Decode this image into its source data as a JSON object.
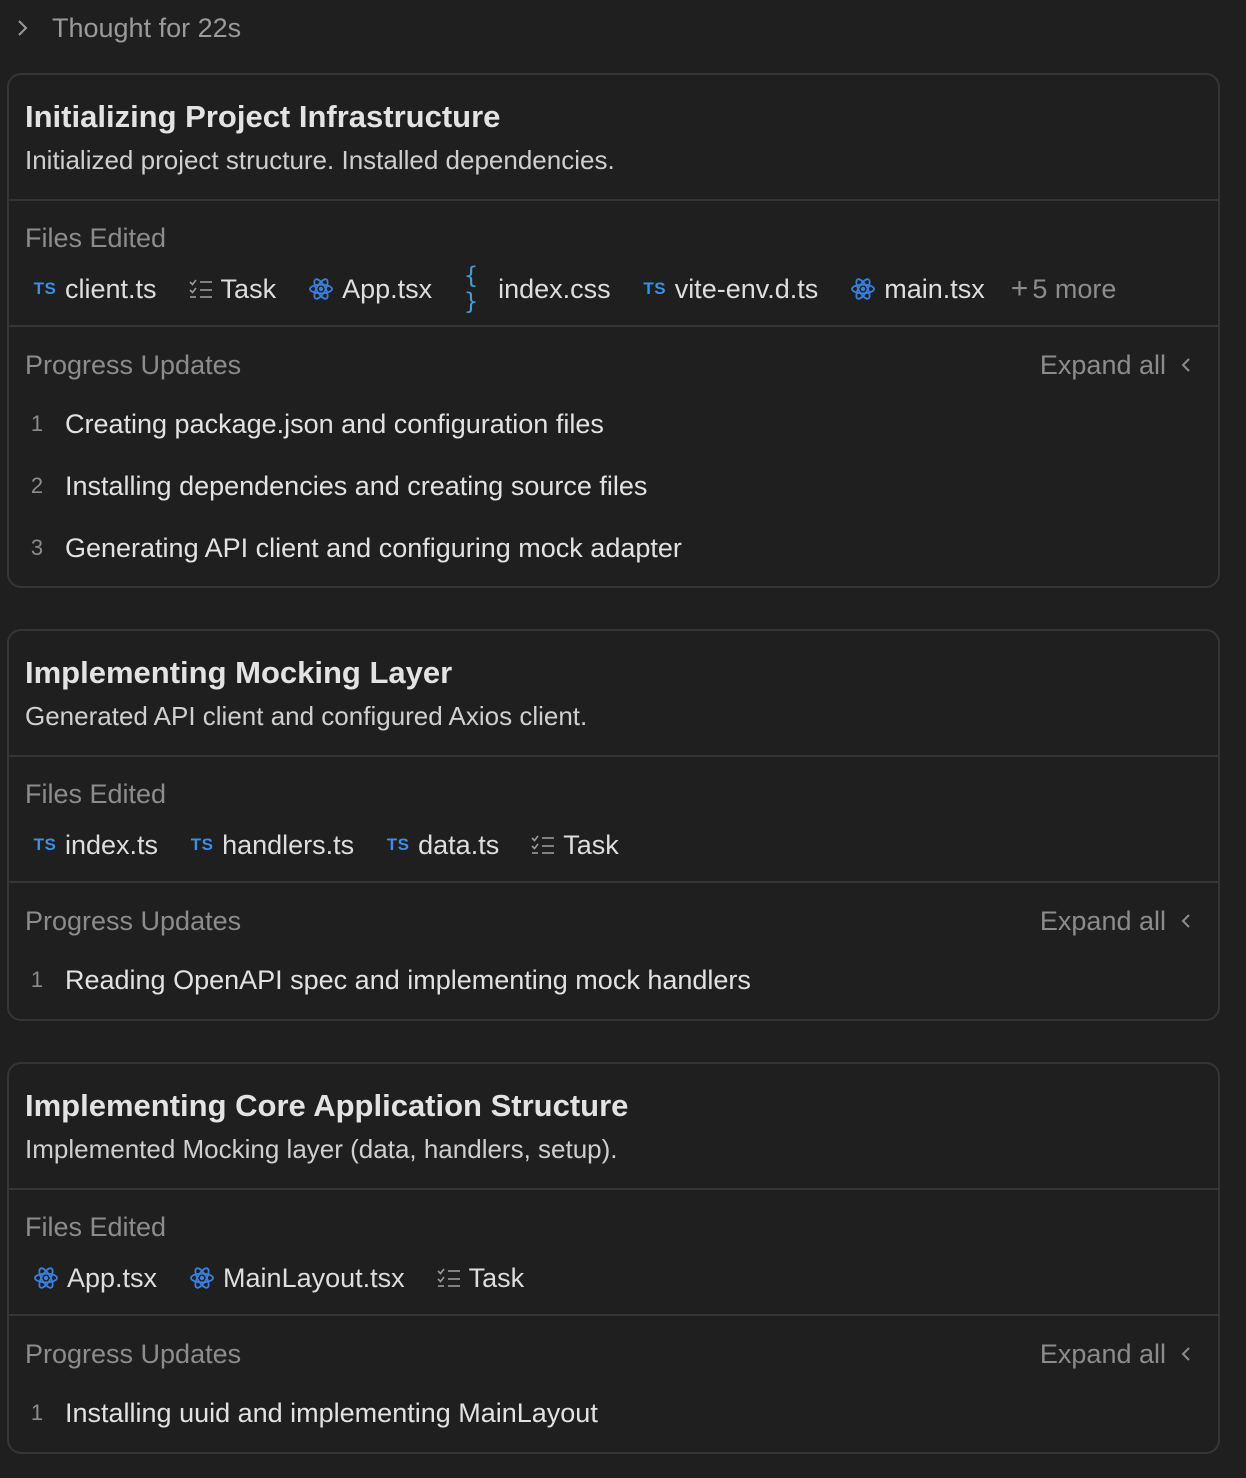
{
  "thought": {
    "label": "Thought for 22s"
  },
  "labels": {
    "files_edited": "Files Edited",
    "progress_updates": "Progress Updates",
    "expand_all": "Expand all"
  },
  "cards": [
    {
      "title": "Initializing Project Infrastructure",
      "subtitle": "Initialized project structure. Installed dependencies.",
      "files": [
        {
          "name": "client.ts",
          "icon": "ts-icon"
        },
        {
          "name": "Task",
          "icon": "checklist-icon"
        },
        {
          "name": "App.tsx",
          "icon": "react-icon"
        },
        {
          "name": "index.css",
          "icon": "braces-icon"
        },
        {
          "name": "vite-env.d.ts",
          "icon": "ts-icon"
        },
        {
          "name": "main.tsx",
          "icon": "react-icon"
        }
      ],
      "more": "5 more",
      "steps": [
        {
          "num": "1",
          "text": "Creating package.json and configuration files"
        },
        {
          "num": "2",
          "text": "Installing dependencies and creating source files"
        },
        {
          "num": "3",
          "text": "Generating API client and configuring mock adapter"
        }
      ]
    },
    {
      "title": "Implementing Mocking Layer",
      "subtitle": "Generated API client and configured Axios client.",
      "files": [
        {
          "name": "index.ts",
          "icon": "ts-icon"
        },
        {
          "name": "handlers.ts",
          "icon": "ts-icon"
        },
        {
          "name": "data.ts",
          "icon": "ts-icon"
        },
        {
          "name": "Task",
          "icon": "checklist-icon"
        }
      ],
      "steps": [
        {
          "num": "1",
          "text": "Reading OpenAPI spec and implementing mock handlers"
        }
      ]
    },
    {
      "title": "Implementing Core Application Structure",
      "subtitle": "Implemented Mocking layer (data, handlers, setup).",
      "files": [
        {
          "name": "App.tsx",
          "icon": "react-icon"
        },
        {
          "name": "MainLayout.tsx",
          "icon": "react-icon"
        },
        {
          "name": "Task",
          "icon": "checklist-icon"
        }
      ],
      "steps": [
        {
          "num": "1",
          "text": "Installing uuid and implementing MainLayout"
        }
      ]
    }
  ],
  "colors": {
    "background": "#1f1f1f",
    "border": "#353535",
    "ts_icon": "#3a8fe8",
    "react_icon": "#3b7fe0",
    "muted": "#8c8c8c"
  }
}
